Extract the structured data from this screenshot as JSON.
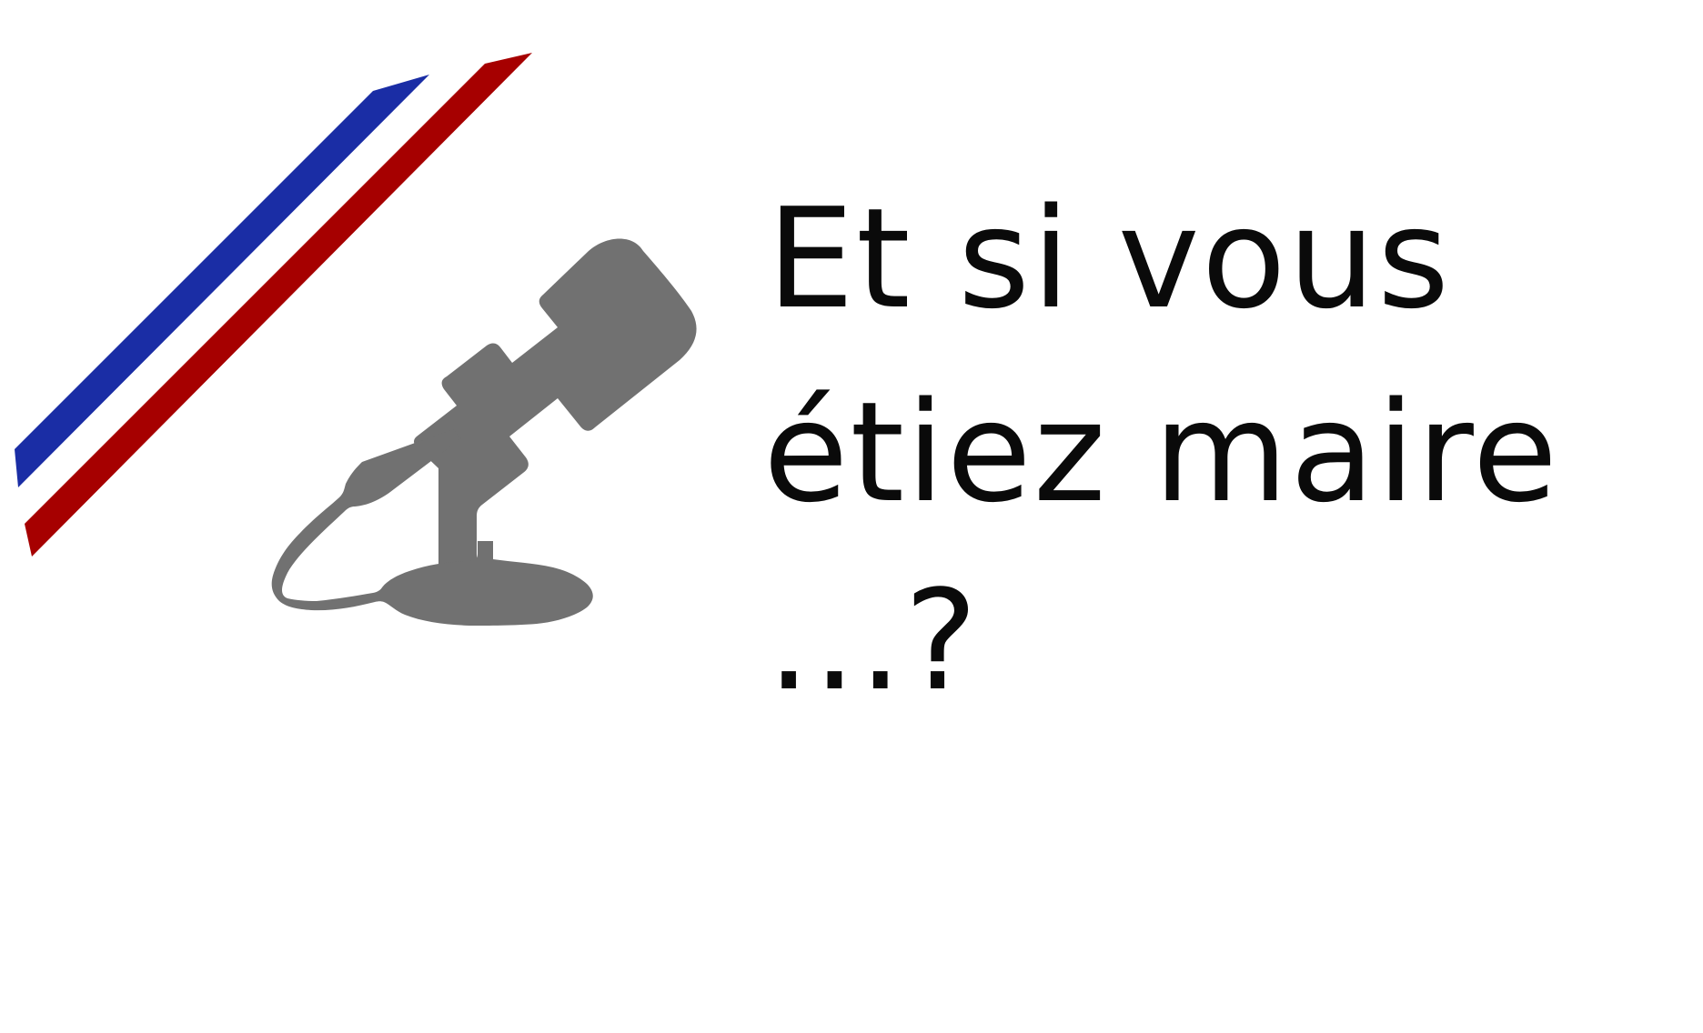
{
  "headline": {
    "line1": "Et si vous",
    "line2": "étiez maire",
    "line3": "...?"
  },
  "colors": {
    "stripe_blue": "#1a2da5",
    "stripe_red": "#a60000",
    "microphone": "#717171",
    "text": "#0a0a0a",
    "background": "#ffffff"
  },
  "icons": {
    "microphone": "microphone-icon",
    "stripes": "tricolor-stripes"
  }
}
